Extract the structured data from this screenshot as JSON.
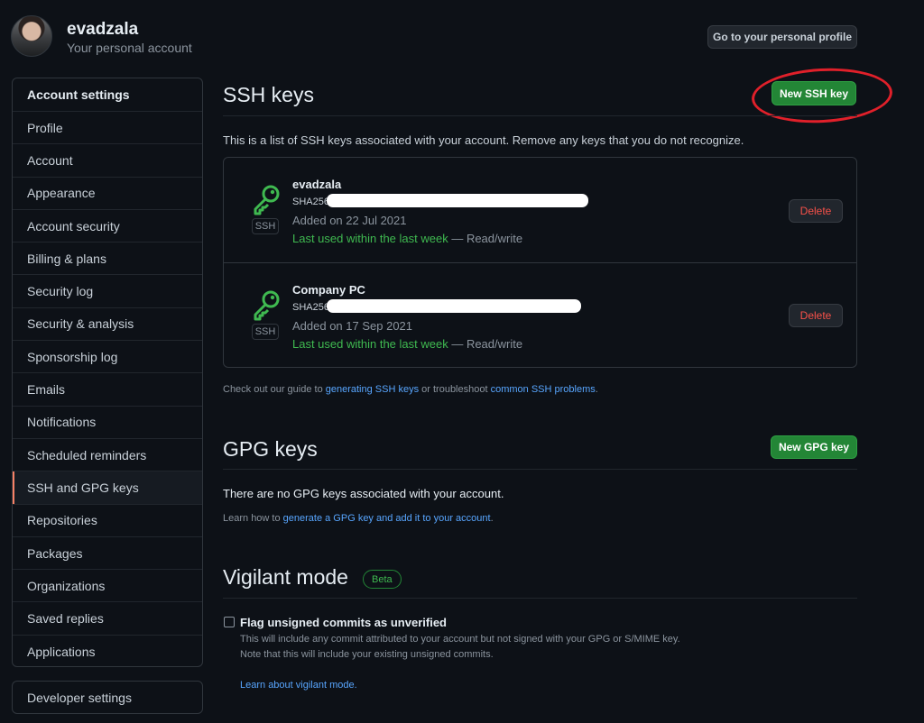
{
  "header": {
    "username": "evadzala",
    "subtitle": "Your personal account",
    "profile_button": "Go to your personal profile"
  },
  "sidebar": {
    "heading": "Account settings",
    "items": [
      {
        "label": "Profile"
      },
      {
        "label": "Account"
      },
      {
        "label": "Appearance"
      },
      {
        "label": "Account security"
      },
      {
        "label": "Billing & plans"
      },
      {
        "label": "Security log"
      },
      {
        "label": "Security & analysis"
      },
      {
        "label": "Sponsorship log"
      },
      {
        "label": "Emails"
      },
      {
        "label": "Notifications"
      },
      {
        "label": "Scheduled reminders"
      },
      {
        "label": "SSH and GPG keys",
        "active": true
      },
      {
        "label": "Repositories"
      },
      {
        "label": "Packages"
      },
      {
        "label": "Organizations"
      },
      {
        "label": "Saved replies"
      },
      {
        "label": "Applications"
      }
    ],
    "developer_settings": "Developer settings"
  },
  "ssh": {
    "title": "SSH keys",
    "new_button": "New SSH key",
    "intro": "This is a list of SSH keys associated with your account. Remove any keys that you do not recognize.",
    "keys": [
      {
        "title": "evadzala",
        "fingerprint_prefix": "SHA256",
        "added": "Added on 22 Jul 2021",
        "last_used": "Last used within the last week",
        "access": " — Read/write",
        "badge": "SSH",
        "delete_label": "Delete"
      },
      {
        "title": "Company PC",
        "fingerprint_prefix": "SHA256",
        "added": "Added on 17 Sep 2021",
        "last_used": "Last used within the last week",
        "access": " — Read/write",
        "badge": "SSH",
        "delete_label": "Delete"
      }
    ],
    "guide_prefix": "Check out our guide to ",
    "guide_link1": "generating SSH keys",
    "guide_mid": " or troubleshoot ",
    "guide_link2": "common SSH problems",
    "guide_suffix": "."
  },
  "gpg": {
    "title": "GPG keys",
    "new_button": "New GPG key",
    "empty": "There are no GPG keys associated with your account.",
    "learn_prefix": "Learn how to ",
    "learn_link": "generate a GPG key and add it to your account",
    "learn_suffix": "."
  },
  "vigilant": {
    "title": "Vigilant mode",
    "badge": "Beta",
    "checkbox_label": "Flag unsigned commits as unverified",
    "checked": false,
    "note1": "This will include any commit attributed to your account but not signed with your GPG or S/MIME key.",
    "note2": "Note that this will include your existing unsigned commits.",
    "learn_link": "Learn about vigilant mode."
  },
  "colors": {
    "background": "#0d1117",
    "accent_green": "#238636",
    "link_blue": "#58a6ff",
    "danger_red": "#f85149",
    "annotation_red": "#e0202a",
    "active_marker": "#f78166"
  }
}
